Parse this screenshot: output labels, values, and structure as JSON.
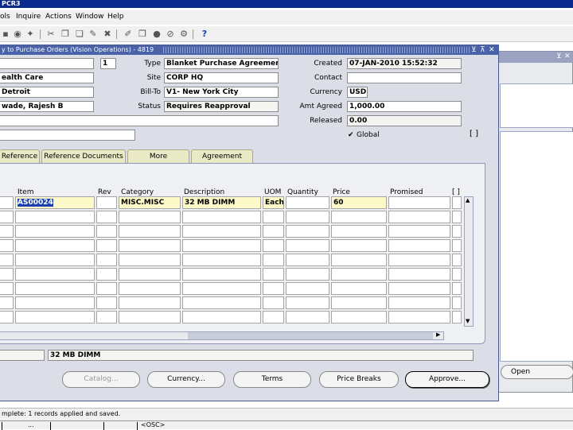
{
  "app": {
    "title": "PCR3"
  },
  "menu": [
    "ols",
    "Inquire",
    "Actions",
    "Window",
    "Help"
  ],
  "toolbar_icons": [
    "printer-icon",
    "find-icon",
    "help-icon",
    "cut-icon",
    "copy-icon",
    "paste-icon",
    "edit-icon",
    "clear-icon",
    "attach-icon",
    "folder-icon",
    "globe-icon",
    "link-icon",
    "zoom-icon",
    "question-icon"
  ],
  "window": {
    "title": "y to Purchase Orders (Vision Operations) - 4819"
  },
  "header": {
    "count": "1",
    "left_fields": [
      "ealth Care",
      "Detroit",
      "wade, Rajesh B"
    ],
    "type_label": "Type",
    "type_value": "Blanket Purchase Agreement",
    "site_label": "Site",
    "site_value": "CORP HQ",
    "billto_label": "Bill-To",
    "billto_value": "V1- New York City",
    "status_label": "Status",
    "status_value": "Requires Reapproval",
    "created_label": "Created",
    "created_value": "07-JAN-2010 15:52:32",
    "contact_label": "Contact",
    "contact_value": "",
    "currency_label": "Currency",
    "currency_value": "USD",
    "amt_label": "Amt Agreed",
    "amt_value": "1,000.00",
    "released_label": "Released",
    "released_value": "0.00",
    "global_label": "Global",
    "bracket": "[ ]"
  },
  "tabs": [
    "Reference",
    "Reference Documents",
    "More",
    "Agreement"
  ],
  "lines": {
    "columns": [
      "Item",
      "Rev",
      "Category",
      "Description",
      "UOM",
      "Quantity",
      "Price",
      "Promised"
    ],
    "rows": [
      {
        "item": "AS00024",
        "rev": "",
        "category": "MISC.MISC",
        "description": "32 MB DIMM",
        "uom": "Each",
        "quantity": "",
        "price": "60",
        "promised": ""
      }
    ],
    "bracket": "[ ]"
  },
  "footer": {
    "description": "32 MB DIMM"
  },
  "buttons": {
    "catalog": "Catalog...",
    "currency": "Currency...",
    "terms": "Terms",
    "price_breaks": "Price Breaks",
    "approve": "Approve...",
    "open": "Open"
  },
  "status": {
    "message": "mplete: 1 records applied and saved.",
    "cell2": "...",
    "cell4": "<OSC>"
  }
}
